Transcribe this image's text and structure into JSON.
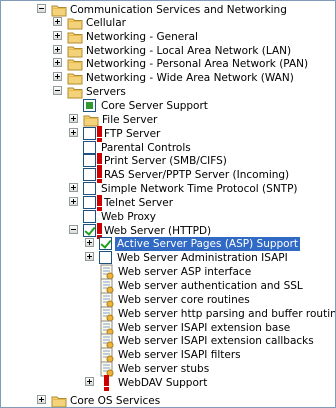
{
  "tree": {
    "rows": [
      {
        "label": "Communication Services and Networking",
        "expander": "minus",
        "check": "none",
        "icon": "folder-icon"
      },
      {
        "label": "Cellular",
        "expander": "plus",
        "check": "none",
        "icon": "folder-icon"
      },
      {
        "label": "Networking - General",
        "expander": "plus",
        "check": "none",
        "icon": "folder-icon"
      },
      {
        "label": "Networking - Local Area Network (LAN)",
        "expander": "plus",
        "check": "none",
        "icon": "folder-icon"
      },
      {
        "label": "Networking - Personal Area Network (PAN)",
        "expander": "plus",
        "check": "none",
        "icon": "folder-icon"
      },
      {
        "label": "Networking - Wide Area Network (WAN)",
        "expander": "plus",
        "check": "none",
        "icon": "folder-icon"
      },
      {
        "label": "Servers",
        "expander": "minus",
        "check": "none",
        "icon": "folder-icon"
      },
      {
        "label": "Core Server Support",
        "expander": "none",
        "check": "partial",
        "icon": "none"
      },
      {
        "label": "File Server",
        "expander": "plus",
        "check": "none",
        "icon": "folder-icon"
      },
      {
        "label": "FTP Server",
        "expander": "plus",
        "check": "unchecked",
        "icon": "warning-icon"
      },
      {
        "label": "Parental Controls",
        "expander": "none",
        "check": "unchecked",
        "icon": "none"
      },
      {
        "label": "Print Server (SMB/CIFS)",
        "expander": "none",
        "check": "unchecked",
        "icon": "warning-icon"
      },
      {
        "label": "RAS Server/PPTP Server (Incoming)",
        "expander": "none",
        "check": "unchecked",
        "icon": "warning-icon"
      },
      {
        "label": "Simple Network Time Protocol (SNTP)",
        "expander": "plus",
        "check": "unchecked",
        "icon": "none"
      },
      {
        "label": "Telnet Server",
        "expander": "plus",
        "check": "unchecked",
        "icon": "warning-icon"
      },
      {
        "label": "Web Proxy",
        "expander": "none",
        "check": "unchecked",
        "icon": "none"
      },
      {
        "label": "Web Server (HTTPD)",
        "expander": "minus",
        "check": "checked",
        "icon": "warning-icon"
      },
      {
        "label": "Active Server Pages (ASP) Support",
        "expander": "plus",
        "check": "checked",
        "icon": "none",
        "selected": true
      },
      {
        "label": "Web Server Administration ISAPI",
        "expander": "plus",
        "check": "unchecked",
        "icon": "none"
      },
      {
        "label": "Web server ASP interface",
        "expander": "none",
        "check": "none",
        "icon": "component-icon"
      },
      {
        "label": "Web server authentication and SSL",
        "expander": "none",
        "check": "none",
        "icon": "component-icon"
      },
      {
        "label": "Web server core routines",
        "expander": "none",
        "check": "none",
        "icon": "component-icon"
      },
      {
        "label": "Web server http parsing and buffer routines",
        "expander": "none",
        "check": "none",
        "icon": "component-icon"
      },
      {
        "label": "Web server ISAPI extension base",
        "expander": "none",
        "check": "none",
        "icon": "component-icon"
      },
      {
        "label": "Web server ISAPI extension callbacks",
        "expander": "none",
        "check": "none",
        "icon": "component-icon"
      },
      {
        "label": "Web server ISAPI filters",
        "expander": "none",
        "check": "none",
        "icon": "component-icon"
      },
      {
        "label": "Web server stubs",
        "expander": "none",
        "check": "none",
        "icon": "component-icon"
      },
      {
        "label": "WebDAV Support",
        "expander": "plus",
        "check": "none",
        "icon": "warning-icon"
      },
      {
        "label": "Core OS Services",
        "expander": "plus",
        "check": "none",
        "icon": "folder-icon"
      }
    ]
  },
  "colors": {
    "selection": "#316ac5",
    "check_green": "#21a121",
    "warning_red": "#cc0000",
    "folder_yellow": "#f3d27a"
  }
}
